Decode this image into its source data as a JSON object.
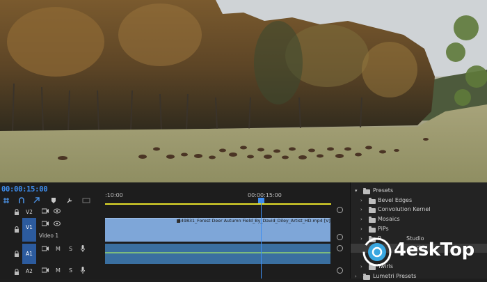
{
  "sequence": {
    "timecode": "00:00:15:00"
  },
  "ruler": {
    "start_label": ":10:00",
    "mid_label": "00:00:15:00"
  },
  "tracks": {
    "v2": {
      "label": "V2"
    },
    "v1": {
      "label": "V1",
      "name": "Video 1"
    },
    "a1": {
      "label": "A1",
      "m": "M",
      "s": "S"
    },
    "a2": {
      "label": "A2",
      "m": "M",
      "s": "S"
    }
  },
  "clip": {
    "title": "549831_Forest Deer Autumn Field_By_David_Diley_Artist_HD.mp4 [V]"
  },
  "effects": {
    "root": "Presets",
    "items": [
      "Bevel Edges",
      "Convolution Kernel",
      "Mosaics",
      "PiPs",
      "Studio",
      "ractor",
      "Twirls",
      "Lumetri Presets"
    ],
    "prefix_item": "P"
  },
  "watermark": {
    "text": "4eskTop"
  },
  "colors": {
    "accent": "#3e8ef0",
    "clip_video": "#7ea6d8",
    "clip_audio": "#3a6fa0",
    "work_area": "#e6e02a"
  }
}
